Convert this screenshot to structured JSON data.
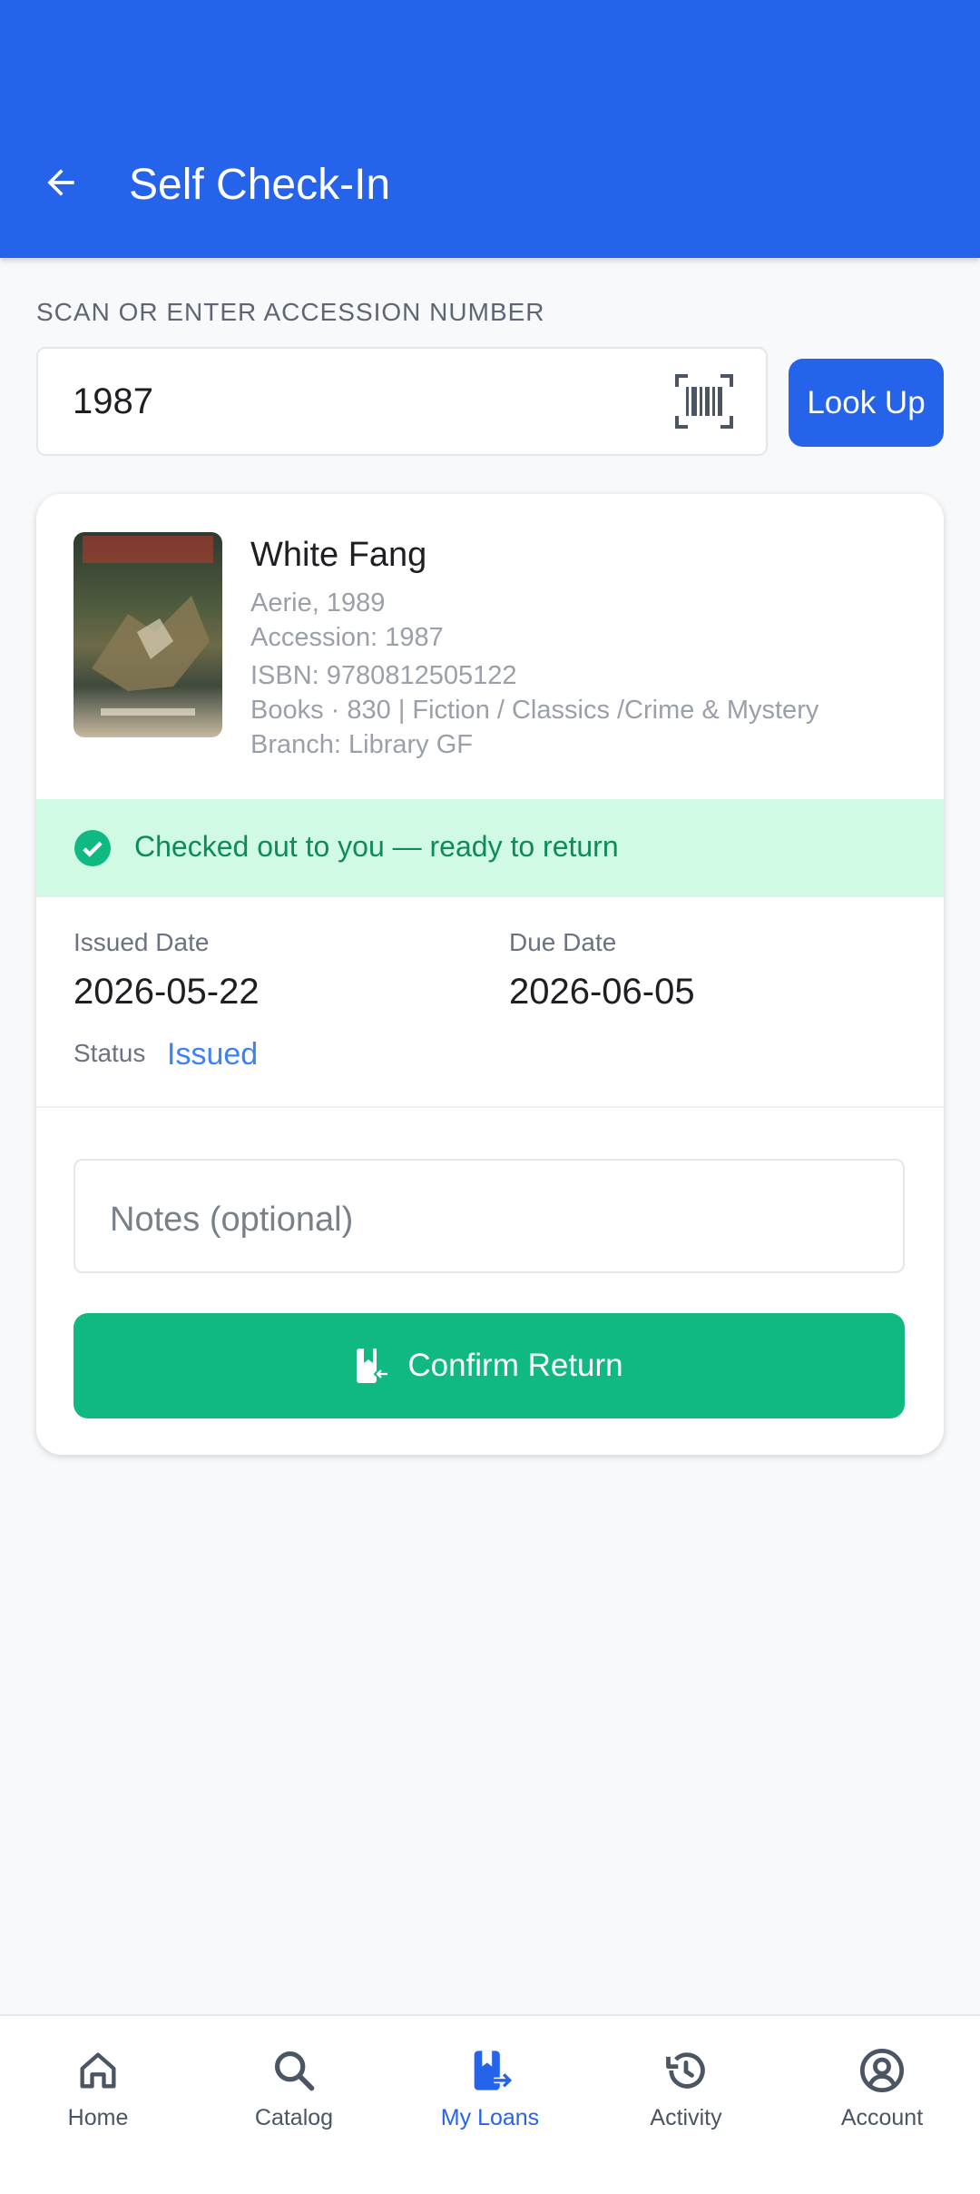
{
  "header": {
    "title": "Self Check-In"
  },
  "scan": {
    "label": "SCAN OR ENTER ACCESSION NUMBER",
    "value": "1987",
    "lookup_label": "Look Up"
  },
  "book": {
    "title": "White Fang",
    "publisher_year": "Aerie, 1989",
    "accession": "Accession: 1987",
    "isbn": "ISBN: 9780812505122",
    "classification": "Books · 830 | Fiction / Classics /Crime & Mystery",
    "branch": "Branch: Library GF"
  },
  "banner": {
    "text": "Checked out to you — ready to return",
    "color": "#0e8a5c"
  },
  "loan": {
    "issued_label": "Issued Date",
    "issued_value": "2026-05-22",
    "due_label": "Due Date",
    "due_value": "2026-06-05",
    "status_label": "Status",
    "status_value": "Issued"
  },
  "notes": {
    "placeholder": "Notes (optional)"
  },
  "confirm": {
    "label": "Confirm Return"
  },
  "nav": {
    "items": [
      {
        "label": "Home",
        "icon": "home-icon"
      },
      {
        "label": "Catalog",
        "icon": "search-icon"
      },
      {
        "label": "My Loans",
        "icon": "book-return-icon",
        "active": true
      },
      {
        "label": "Activity",
        "icon": "history-icon"
      },
      {
        "label": "Account",
        "icon": "account-icon"
      }
    ]
  },
  "colors": {
    "primary": "#2563eb",
    "success": "#10b981",
    "success_bg": "#d1fae5"
  }
}
